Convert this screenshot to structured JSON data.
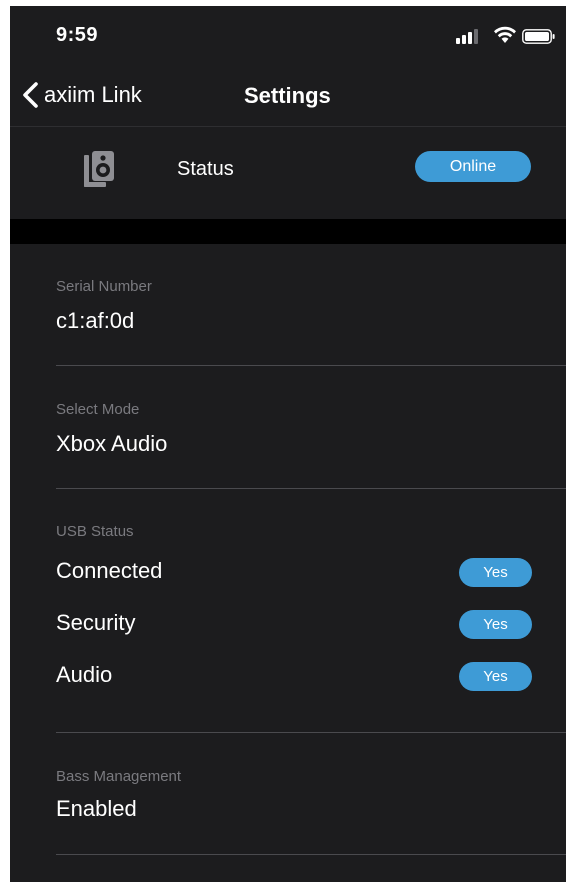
{
  "status_bar": {
    "time": "9:59"
  },
  "nav": {
    "back_label": "axiim Link",
    "title": "Settings"
  },
  "status_row": {
    "label": "Status",
    "badge": "Online"
  },
  "serial": {
    "label": "Serial Number",
    "value": "c1:af:0d"
  },
  "mode": {
    "label": "Select Mode",
    "value": "Xbox Audio"
  },
  "usb": {
    "label": "USB Status",
    "rows": [
      {
        "label": "Connected",
        "badge": "Yes"
      },
      {
        "label": "Security",
        "badge": "Yes"
      },
      {
        "label": "Audio",
        "badge": "Yes"
      }
    ]
  },
  "bass": {
    "label": "Bass Management",
    "value": "Enabled"
  },
  "colors": {
    "background": "#1c1c1e",
    "accent": "#3e9bd6",
    "secondary_text": "#7a7a7f"
  }
}
